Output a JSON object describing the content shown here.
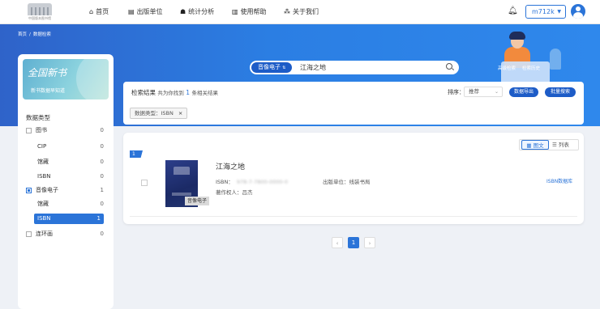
{
  "header": {
    "logo_text": "中国版本图书馆",
    "nav": [
      {
        "icon": "home-icon",
        "glyph": "⌂",
        "label": "首页"
      },
      {
        "icon": "book-icon",
        "glyph": "▤",
        "label": "出版单位"
      },
      {
        "icon": "users-icon",
        "glyph": "☗",
        "label": "统计分析"
      },
      {
        "icon": "help-book-icon",
        "glyph": "▥",
        "label": "使用帮助"
      },
      {
        "icon": "network-icon",
        "glyph": "⁂",
        "label": "关于我们"
      }
    ],
    "user": "m712k"
  },
  "breadcrumb": [
    "首页",
    "/",
    "数据检索"
  ],
  "search": {
    "type": "音像电子",
    "type_caret": "⇅",
    "query": "江海之地",
    "advanced": "高级检索",
    "history": "检索历史"
  },
  "sidebar": {
    "card_title": "全国新书",
    "card_sub": "新书数据早知道",
    "heading": "数据类型",
    "items": [
      {
        "label": "图书",
        "count": "0"
      },
      {
        "label": "CIP",
        "count": "0"
      },
      {
        "label": "馆藏",
        "count": "0"
      },
      {
        "label": "ISBN",
        "count": "0"
      },
      {
        "label": "音像电子",
        "count": "1"
      },
      {
        "label": "馆藏",
        "count": "0"
      },
      {
        "label": "ISBN",
        "count": "1"
      },
      {
        "label": "连环画",
        "count": "0"
      }
    ]
  },
  "results": {
    "header_prefix": "检索结果",
    "header_mid": "共为你找到",
    "count": "1",
    "header_suffix": "条相关结果",
    "sort_label": "排序：",
    "sort_value": "推荐",
    "export": "数据导出",
    "batch": "批量搜索",
    "chip": "数据类型：ISBN",
    "chip_close": "×"
  },
  "list": {
    "view_grid": "图文",
    "view_list": "列表",
    "index": "1",
    "item": {
      "title": "江海之地",
      "isbn_label": "ISBN：",
      "isbn_value": "978-7-7800-0000-0",
      "author": "著作权人：吕杰",
      "publisher": "出版单位：线装书局",
      "link": "ISBN数据库",
      "cover_tag": "音像电子"
    }
  },
  "pagination": {
    "prev": "‹",
    "current": "1",
    "next": "›"
  }
}
